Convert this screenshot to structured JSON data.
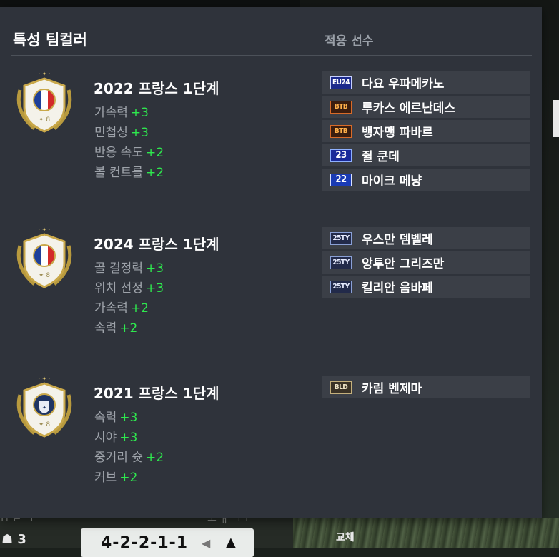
{
  "panel": {
    "title": "특성 팀컬러",
    "players_header": "적용 선수"
  },
  "sections": [
    {
      "team": "2022 프랑스 1단계",
      "emblem": "france-flag-shield-emblem",
      "stats": [
        {
          "label": "가속력",
          "bonus": "+3"
        },
        {
          "label": "민첩성",
          "bonus": "+3"
        },
        {
          "label": "반응 속도",
          "bonus": "+2"
        },
        {
          "label": "볼 컨트롤",
          "bonus": "+2"
        }
      ],
      "players": [
        {
          "badge": "EU24",
          "name": "다요 우파메카노"
        },
        {
          "badge": "BTB",
          "name": "루카스 에르난데스"
        },
        {
          "badge": "BTB",
          "name": "뱅자맹 파바르"
        },
        {
          "badge": "23",
          "name": "쥘 쿤데"
        },
        {
          "badge": "22",
          "name": "마이크 메냥"
        }
      ]
    },
    {
      "team": "2024 프랑스 1단계",
      "emblem": "france-flag-shield-emblem",
      "stats": [
        {
          "label": "골 결정력",
          "bonus": "+3"
        },
        {
          "label": "위치 선정",
          "bonus": "+3"
        },
        {
          "label": "가속력",
          "bonus": "+2"
        },
        {
          "label": "속력",
          "bonus": "+2"
        }
      ],
      "players": [
        {
          "badge": "25TY",
          "name": "우스만 뎀벨레"
        },
        {
          "badge": "25TY",
          "name": "앙투안 그리즈만"
        },
        {
          "badge": "25TY",
          "name": "킬리안 음바페"
        }
      ]
    },
    {
      "team": "2021 프랑스 1단계",
      "emblem": "fff-crest-shield-emblem",
      "stats": [
        {
          "label": "속력",
          "bonus": "+3"
        },
        {
          "label": "시야",
          "bonus": "+3"
        },
        {
          "label": "중거리 슛",
          "bonus": "+2"
        },
        {
          "label": "커브",
          "bonus": "+2"
        }
      ],
      "players": [
        {
          "badge": "BLD",
          "name": "카림 벤제마"
        }
      ]
    }
  ],
  "background": {
    "formation": "4-2-2-1-1",
    "count": "3",
    "substitute_label": "교체"
  },
  "colors": {
    "panel_bg": "#2f333b",
    "row_bg": "#3b3f47",
    "bonus_green": "#2ee84e",
    "stat_gray": "#9ea3aa"
  }
}
